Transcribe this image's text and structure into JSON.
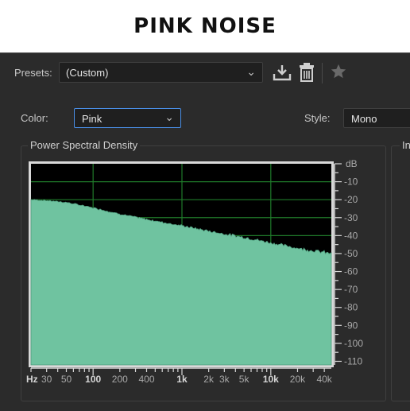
{
  "page_title": "PINK NOISE",
  "presets": {
    "label": "Presets:",
    "value": "(Custom)"
  },
  "color": {
    "label": "Color:",
    "value": "Pink"
  },
  "style": {
    "label": "Style:",
    "value": "Mono"
  },
  "psd_panel": {
    "title": "Power Spectral Density"
  },
  "right_panel": {
    "title": "In"
  },
  "colors": {
    "panel_bg": "#2b2b2b",
    "plot_bg": "#000000",
    "grid": "#1f7a2a",
    "fill": "#6fc3a0",
    "focus_border": "#4a8fe7",
    "tick_text": "#a9a9a9",
    "tick_text_bold": "#d6d6d6"
  },
  "icons": [
    "save-preset-icon",
    "delete-preset-icon",
    "favorite-star-icon",
    "chevron-down-icon"
  ],
  "chart_data": {
    "type": "area",
    "title": "",
    "xscale": "log",
    "xlim": [
      20,
      48000
    ],
    "ylim": [
      -112,
      0
    ],
    "grid": true,
    "x_tick_labels": [
      {
        "value": 30,
        "label": "30",
        "major": false
      },
      {
        "value": 50,
        "label": "50",
        "major": false
      },
      {
        "value": 100,
        "label": "100",
        "major": true
      },
      {
        "value": 200,
        "label": "200",
        "major": false
      },
      {
        "value": 400,
        "label": "400",
        "major": false
      },
      {
        "value": 1000,
        "label": "1k",
        "major": true
      },
      {
        "value": 2000,
        "label": "2k",
        "major": false
      },
      {
        "value": 3000,
        "label": "3k",
        "major": false
      },
      {
        "value": 5000,
        "label": "5k",
        "major": false
      },
      {
        "value": 10000,
        "label": "10k",
        "major": true
      },
      {
        "value": 20000,
        "label": "20k",
        "major": false
      },
      {
        "value": 40000,
        "label": "40k",
        "major": false
      }
    ],
    "x_unit": "Hz",
    "y_unit": "dB",
    "y_tick_labels": [
      {
        "value": -10,
        "label": "-10"
      },
      {
        "value": -20,
        "label": "-20"
      },
      {
        "value": -30,
        "label": "-30"
      },
      {
        "value": -40,
        "label": "-40"
      },
      {
        "value": -50,
        "label": "-50"
      },
      {
        "value": -60,
        "label": "-60"
      },
      {
        "value": -70,
        "label": "-70"
      },
      {
        "value": -80,
        "label": "-80"
      },
      {
        "value": -90,
        "label": "-90"
      },
      {
        "value": -100,
        "label": "-100"
      },
      {
        "value": -110,
        "label": "-110"
      }
    ],
    "x_grid": [
      100,
      1000,
      10000
    ],
    "y_grid": [
      -10,
      -20,
      -30,
      -40,
      -50
    ],
    "series": [
      {
        "points": [
          {
            "x": 20,
            "y": -20
          },
          {
            "x": 30,
            "y": -20.5
          },
          {
            "x": 50,
            "y": -21.5
          },
          {
            "x": 100,
            "y": -24.5
          },
          {
            "x": 200,
            "y": -28
          },
          {
            "x": 400,
            "y": -31
          },
          {
            "x": 1000,
            "y": -34.5
          },
          {
            "x": 2000,
            "y": -37.5
          },
          {
            "x": 5000,
            "y": -41
          },
          {
            "x": 10000,
            "y": -44
          },
          {
            "x": 20000,
            "y": -47
          },
          {
            "x": 48000,
            "y": -50
          }
        ]
      }
    ]
  }
}
